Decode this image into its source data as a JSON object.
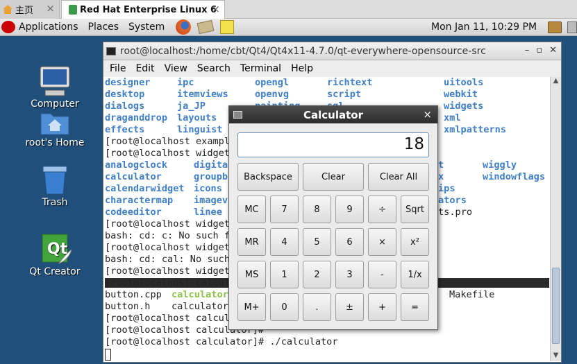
{
  "browser_tabs": [
    {
      "label": "主页",
      "close": "×"
    },
    {
      "label": "Red Hat Enterprise Linux 6",
      "close": "×"
    }
  ],
  "panel": {
    "menus": [
      "Applications",
      "Places",
      "System"
    ],
    "clock": "Mon Jan 11, 10:29 PM"
  },
  "desktop_icons": [
    {
      "label": "Computer"
    },
    {
      "label": "root's Home"
    },
    {
      "label": "Trash"
    },
    {
      "label": "Qt Creator"
    }
  ],
  "terminal": {
    "title": "root@localhost:/home/cbt/Qt4/Qt4x11-4.7.0/qt-everywhere-opensource-src",
    "menus": [
      "File",
      "Edit",
      "View",
      "Search",
      "Terminal",
      "Help"
    ],
    "lines": [
      "[root@localhost example",
      "[root@localhost widget",
      "[root@localhost widget",
      "bash: cd: c: No such f",
      "[root@localhost widget",
      "bash: cd: cal: No such",
      "[root@localhost widget",
      "[root@localhost calcula",
      "[root@localhost calcula",
      "[root@localhost calculator]#",
      "[root@localhost calculator]# ./calculator"
    ],
    "dirs_row1": [
      "designer",
      "ipc",
      "opengl",
      "richtext",
      "uitools"
    ],
    "dirs_row2": [
      "desktop",
      "itemviews",
      "openvg",
      "script",
      "webkit"
    ],
    "dirs_row3": [
      "dialogs",
      "ja_JP",
      "painting",
      "sql",
      "widgets"
    ],
    "dirs_row4": [
      "draganddrop",
      "layouts",
      "xml"
    ],
    "dirs_row5": [
      "effects",
      "linguist",
      "xmlpatterns"
    ],
    "widgets_col1": [
      "analogclock",
      "calculator",
      "calendarwidget",
      "charactermap",
      "codeeditor"
    ],
    "widgets_col2": [
      "digita",
      "groupb",
      "icons",
      "imagev",
      "linee"
    ],
    "widgets_right": [
      "t",
      "x",
      "ips",
      "ators"
    ],
    "widgets_right2": [
      "wiggly",
      "windowflags"
    ],
    "widgets_pro": "ts.pro",
    "files": {
      "button_cpp": "button.cpp",
      "calculator_exe": "calculator",
      "button_h": "button.h",
      "calculator2": "calculator",
      "makefile": "Makefile"
    }
  },
  "calculator": {
    "title": "Calculator",
    "display": "18",
    "buttons": {
      "backspace": "Backspace",
      "clear": "Clear",
      "clear_all": "Clear All",
      "mc": "MC",
      "mr": "MR",
      "ms": "MS",
      "mplus": "M+",
      "n7": "7",
      "n8": "8",
      "n9": "9",
      "div": "÷",
      "sqrt": "Sqrt",
      "n4": "4",
      "n5": "5",
      "n6": "6",
      "mul": "×",
      "sq": "x²",
      "n1": "1",
      "n2": "2",
      "n3": "3",
      "minus": "-",
      "inv": "1/x",
      "n0": "0",
      "dot": ".",
      "pm": "±",
      "plus": "+",
      "eq": "="
    }
  }
}
